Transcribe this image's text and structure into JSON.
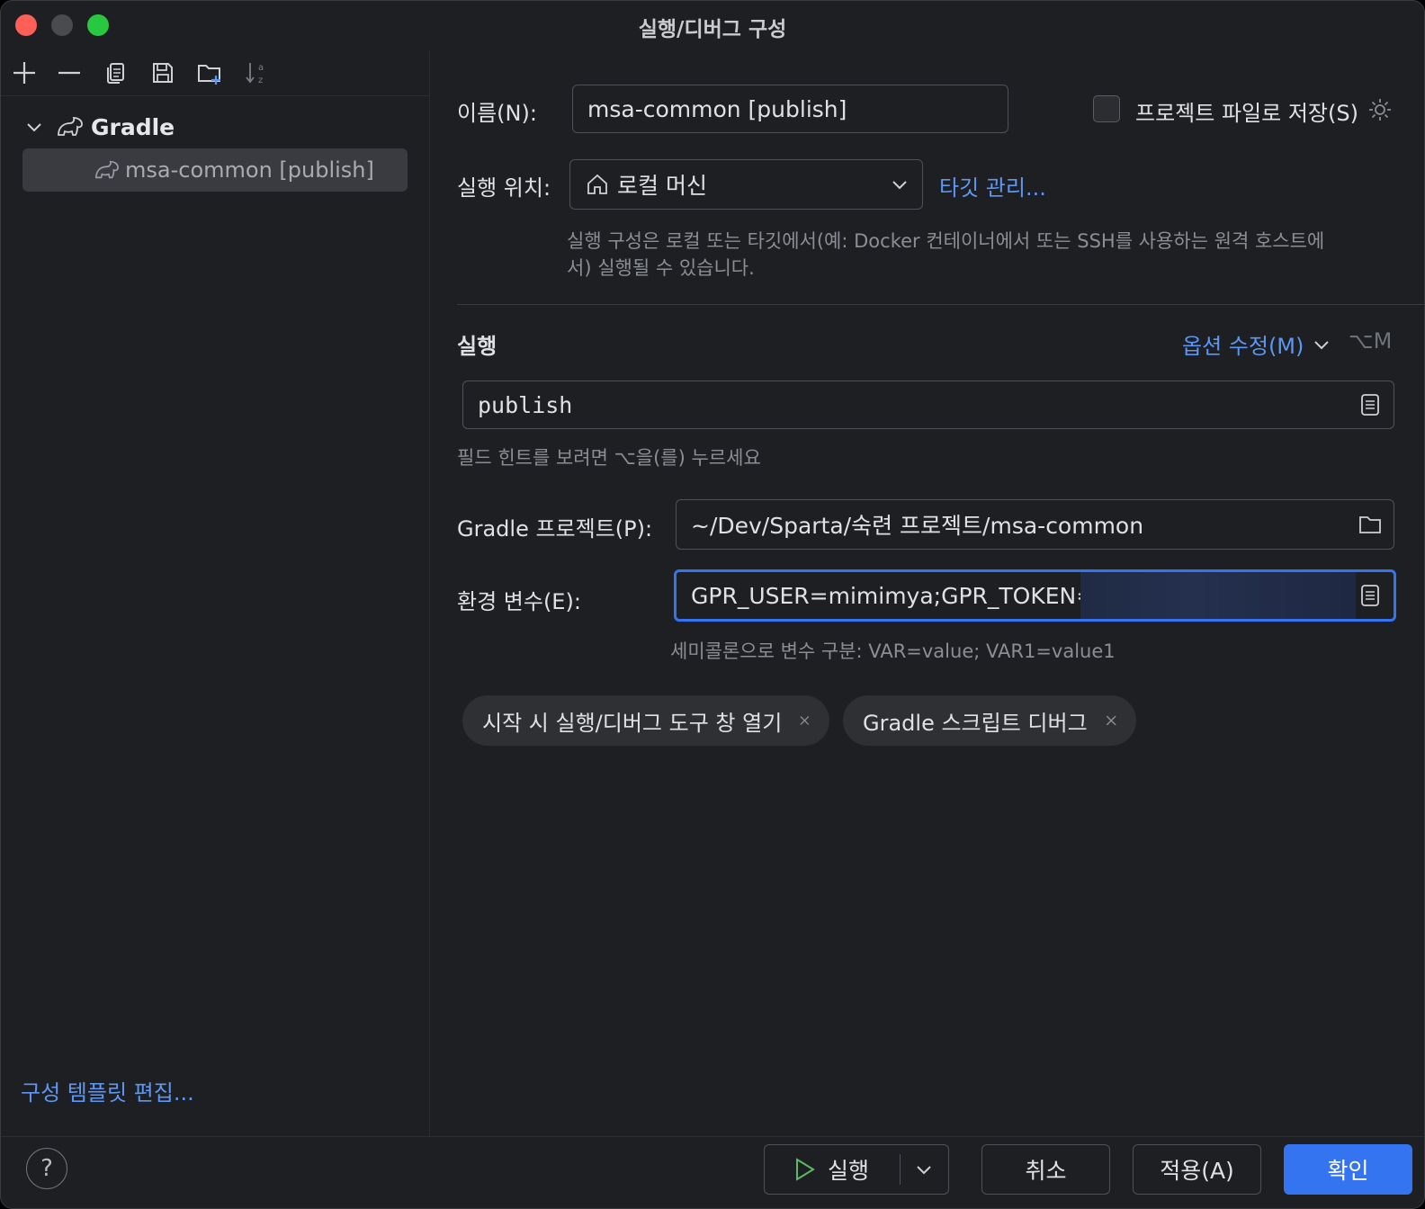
{
  "window": {
    "title": "실행/디버그 구성"
  },
  "left": {
    "tree": {
      "group_label": "Gradle",
      "items": [
        {
          "label": "msa-common [publish]"
        }
      ]
    },
    "edit_templates_label": "구성 템플릿 편집..."
  },
  "form": {
    "name_label": "이름(N):",
    "name_value": "msa-common [publish]",
    "store_label": "프로젝트 파일로 저장(S)",
    "run_on_label": "실행 위치:",
    "run_on_value": "로컬 머신",
    "manage_targets_label": "타깃 관리...",
    "run_on_hint_line1": "실행 구성은 로컬 또는 타깃에서(예: Docker 컨테이너에서 또는 SSH를 사용하는 원격 호스트에",
    "run_on_hint_line2": "서) 실행될 수 있습니다.",
    "run_section_label": "실행",
    "modify_options_label": "옵션 수정(M)",
    "modify_options_shortcut": "⌥M",
    "tasks_value": "publish",
    "tasks_hint": "필드 힌트를 보려면 ⌥을(를) 누르세요",
    "project_label": "Gradle 프로젝트(P):",
    "project_value": "~/Dev/Sparta/숙련 프로젝트/msa-common",
    "env_label": "환경 변수(E):",
    "env_value": "GPR_USER=mimimya;GPR_TOKEN=",
    "env_hint": "세미콜론으로 변수 구분: VAR=value; VAR1=value1",
    "chips": [
      {
        "label": "시작 시 실행/디버그 도구 창 열기"
      },
      {
        "label": "Gradle 스크립트 디버그"
      }
    ]
  },
  "buttons": {
    "help": "?",
    "run": "실행",
    "cancel": "취소",
    "apply": "적용(A)",
    "ok": "확인"
  },
  "colors": {
    "background": "#1e1f22",
    "accent": "#3574f0",
    "link": "#5d97f5",
    "selection": "#393b40"
  }
}
